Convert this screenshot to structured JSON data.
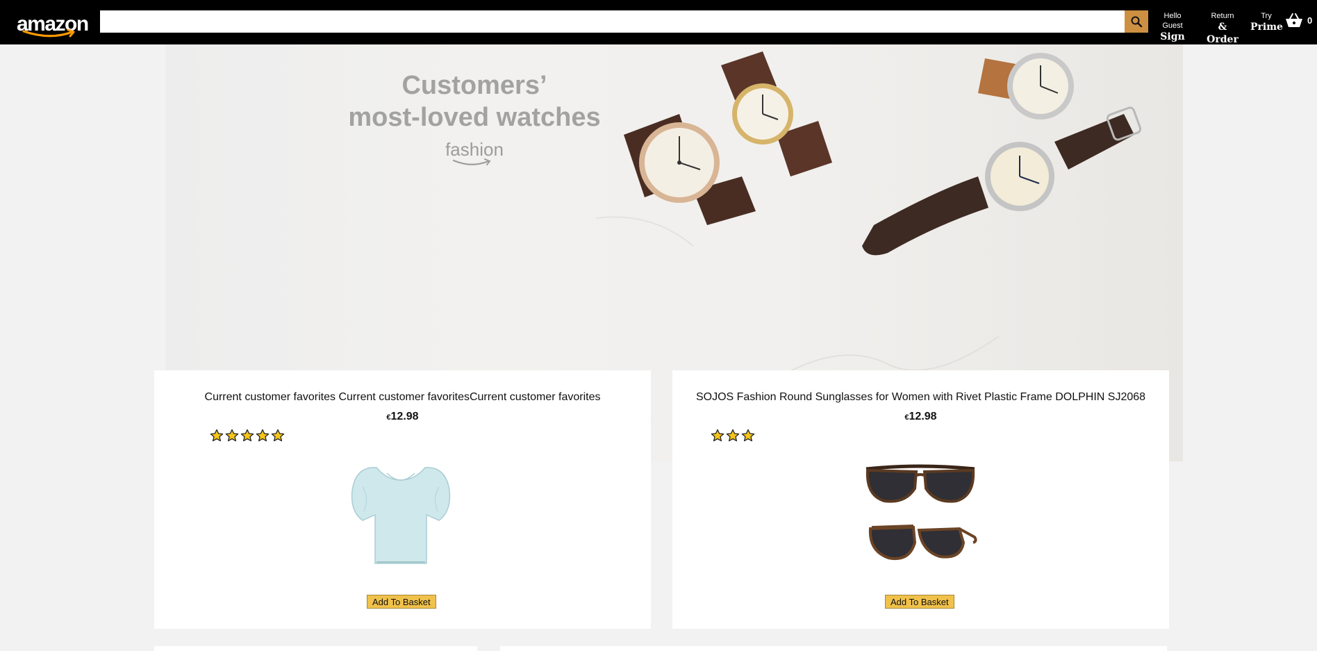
{
  "header": {
    "logo_text": "amazon",
    "search": {
      "value": "",
      "placeholder": ""
    },
    "nav": [
      {
        "line1": "Hello Guest",
        "line2": "Sign In"
      },
      {
        "line1": "Return",
        "line2": "& Order"
      },
      {
        "line1": "Try",
        "line2": "Prime"
      }
    ],
    "basket_count": "0"
  },
  "hero": {
    "title_line1": "Customers’",
    "title_line2": "most-loved watches",
    "brand": "fashion"
  },
  "products": [
    {
      "title": "Current customer favorites Current customer favoritesCurrent customer favorites",
      "currency": "€",
      "price": "12.98",
      "rating": 5,
      "image": "light-blue-blouse",
      "button_label": "Add To Basket"
    },
    {
      "title": "SOJOS Fashion Round Sunglasses for Women with Rivet Plastic Frame DOLPHIN SJ2068",
      "currency": "€",
      "price": "12.98",
      "rating": 3,
      "image": "tortoise-sunglasses",
      "button_label": "Add To Basket"
    }
  ],
  "colors": {
    "header_bg": "#000000",
    "search_button": "#cd9042",
    "button_bg": "#f0c14b",
    "star": "#f5c518",
    "page_bg": "#f2f2f2"
  }
}
